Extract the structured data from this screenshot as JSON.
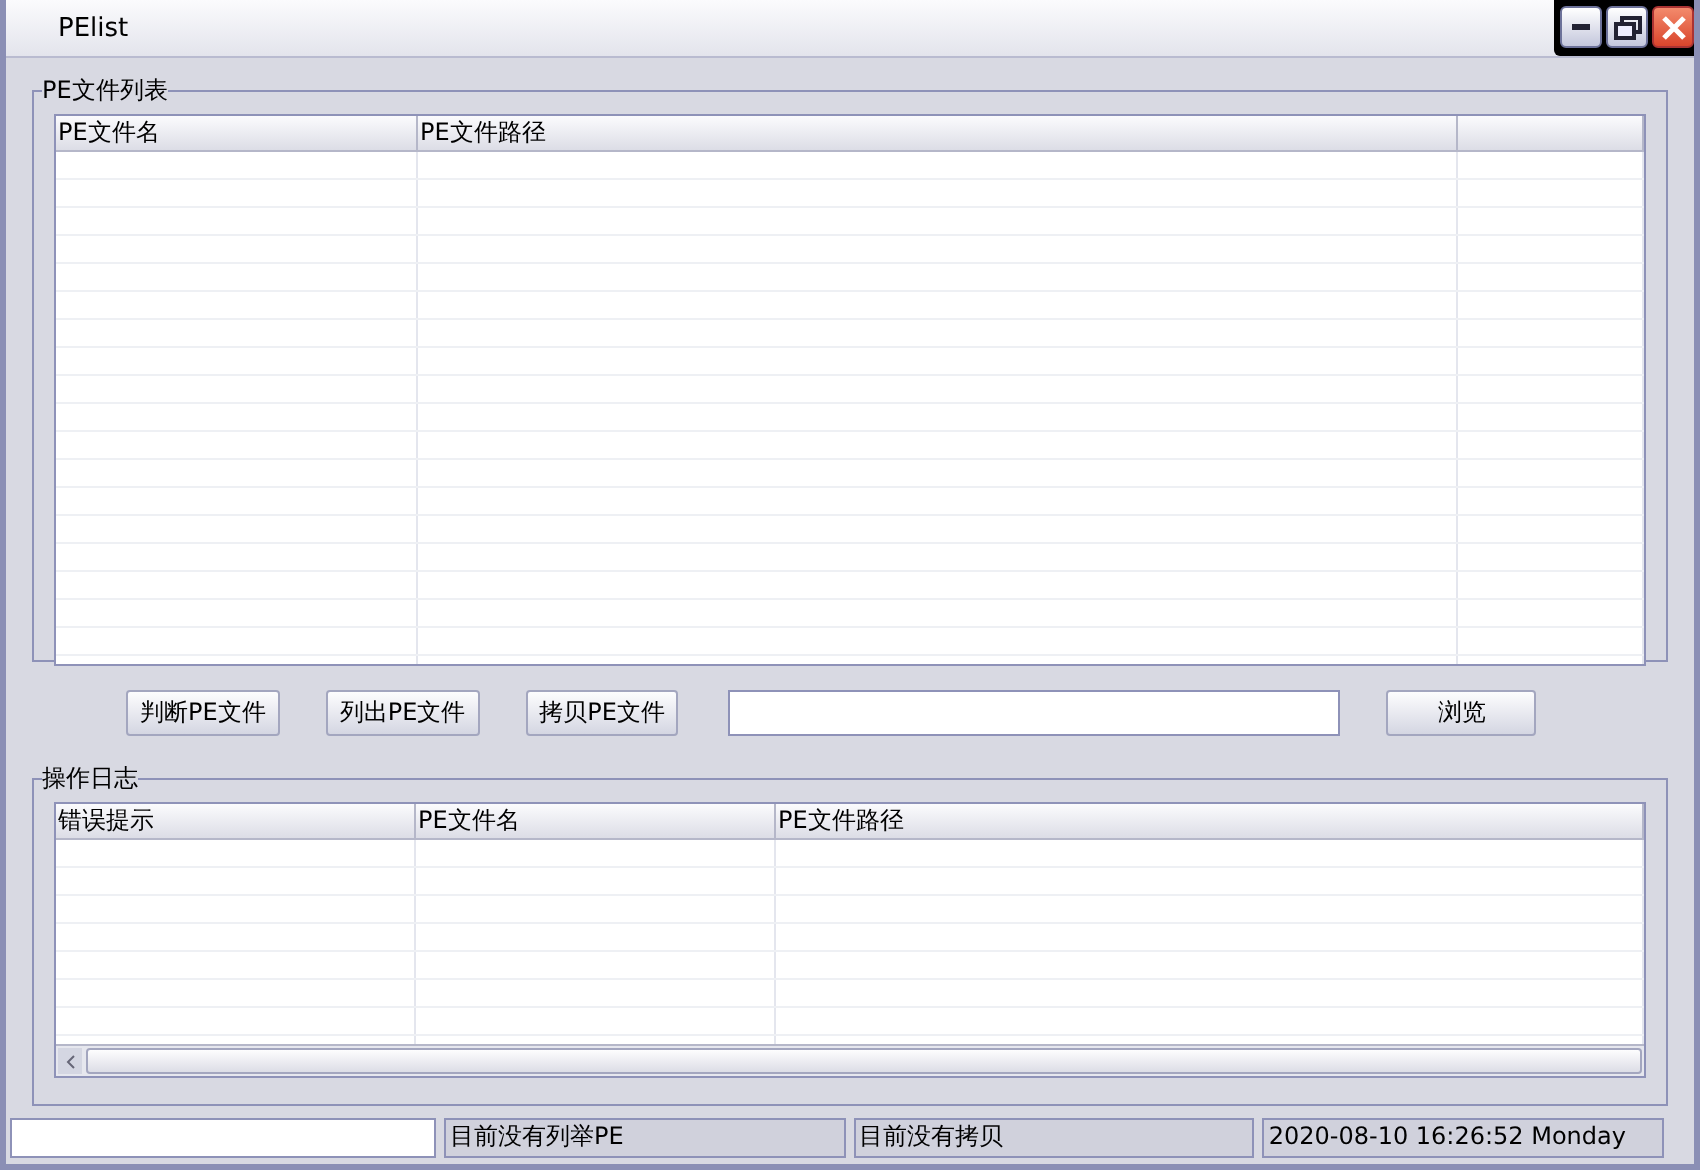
{
  "window": {
    "title": "PElist"
  },
  "file_list": {
    "title": "PE文件列表",
    "columns": [
      "PE文件名",
      "PE文件路径"
    ]
  },
  "actions": {
    "buttons": [
      "判断PE文件",
      "列出PE文件",
      "拷贝PE文件"
    ],
    "browse_button": "浏览"
  },
  "log": {
    "title": "操作日志",
    "columns": [
      "错误提示",
      "PE文件名",
      "PE文件路径"
    ]
  },
  "status_bar": [
    "目前没有列举PE",
    "目前没有拷贝",
    "2020-08-10 16:26:52 Monday"
  ]
}
